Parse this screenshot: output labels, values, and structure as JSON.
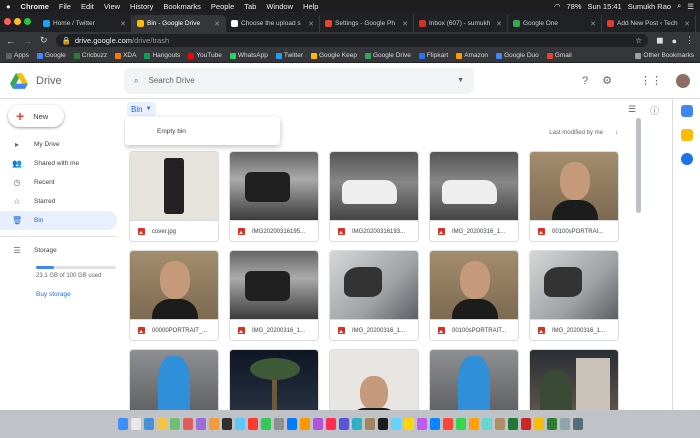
{
  "menubar": {
    "app": "Chrome",
    "items": [
      "File",
      "Edit",
      "View",
      "History",
      "Bookmarks",
      "People",
      "Tab",
      "Window",
      "Help"
    ],
    "battery": "78%",
    "time": "Sun 15:41",
    "user": "Sumukh Rao"
  },
  "tabs": [
    {
      "label": "Home / Twitter",
      "color": "#1da1f2",
      "active": false
    },
    {
      "label": "Bin - Google Drive",
      "color": "#fbbc04",
      "active": true
    },
    {
      "label": "Choose the upload s",
      "color": "#ffffff",
      "active": false
    },
    {
      "label": "Settings - Google Ph",
      "color": "#ea4335",
      "active": false
    },
    {
      "label": "Inbox (607) - sumukh",
      "color": "#d93025",
      "active": false
    },
    {
      "label": "Google One",
      "color": "#34a853",
      "active": false
    },
    {
      "label": "Add New Post ‹ Tech",
      "color": "#e53935",
      "active": false
    }
  ],
  "address": {
    "host": "drive.google.com",
    "path": "/drive/trash"
  },
  "bookmarks": [
    {
      "label": "Apps",
      "color": "#5f6368"
    },
    {
      "label": "Google",
      "color": "#4285f4"
    },
    {
      "label": "Cricbuzz",
      "color": "#2e7d32"
    },
    {
      "label": "XDA",
      "color": "#f57c00"
    },
    {
      "label": "Hangouts",
      "color": "#0f9d58"
    },
    {
      "label": "YouTube",
      "color": "#ff0000"
    },
    {
      "label": "WhatsApp",
      "color": "#25d366"
    },
    {
      "label": "Twitter",
      "color": "#1da1f2"
    },
    {
      "label": "Google Keep",
      "color": "#fbbc04"
    },
    {
      "label": "Google Drive",
      "color": "#34a853"
    },
    {
      "label": "Flipkart",
      "color": "#2874f0"
    },
    {
      "label": "Amazon",
      "color": "#ff9900"
    },
    {
      "label": "Google Duo",
      "color": "#4285f4"
    },
    {
      "label": "Gmail",
      "color": "#ea4335"
    }
  ],
  "other_bookmarks": "Other Bookmarks",
  "drive": {
    "name": "Drive",
    "search_placeholder": "Search Drive",
    "new_label": "New",
    "nav": [
      {
        "label": "My Drive",
        "icon": "drive-icon",
        "glyph": "▸",
        "active": false
      },
      {
        "label": "Shared with me",
        "icon": "people-icon",
        "glyph": "👥",
        "active": false
      },
      {
        "label": "Recent",
        "icon": "clock-icon",
        "glyph": "◷",
        "active": false
      },
      {
        "label": "Starred",
        "icon": "star-icon",
        "glyph": "☆",
        "active": false
      },
      {
        "label": "Bin",
        "icon": "trash-icon",
        "glyph": "🗑",
        "active": true
      }
    ],
    "storage_label": "Storage",
    "storage_used": "23.1 GB of 100 GB used",
    "storage_fraction": 0.231,
    "buy_storage": "Buy storage",
    "bin_label": "Bin",
    "empty_bin": "Empty bin",
    "sort_label": "Last modified by me",
    "files": [
      {
        "name": "cover.jpg",
        "thumb": "phone"
      },
      {
        "name": "IMG20200316195...",
        "thumb": "garage"
      },
      {
        "name": "IMG20200316193...",
        "thumb": "car"
      },
      {
        "name": "IMG_20200316_1...",
        "thumb": "car"
      },
      {
        "name": "00100sPORTRAI...",
        "thumb": "face"
      },
      {
        "name": "00000PORTRAIT_...",
        "thumb": "face"
      },
      {
        "name": "IMG_20200316_1...",
        "thumb": "garage"
      },
      {
        "name": "IMG_20200316_1...",
        "thumb": "mirror"
      },
      {
        "name": "00100sPORTRAIT...",
        "thumb": "face"
      },
      {
        "name": "IMG_20200316_1...",
        "thumb": "mirror"
      },
      {
        "name": "",
        "thumb": "bird"
      },
      {
        "name": "",
        "thumb": "palm"
      },
      {
        "name": "",
        "thumb": "face2"
      },
      {
        "name": "",
        "thumb": "bird"
      },
      {
        "name": "",
        "thumb": "build"
      }
    ]
  }
}
